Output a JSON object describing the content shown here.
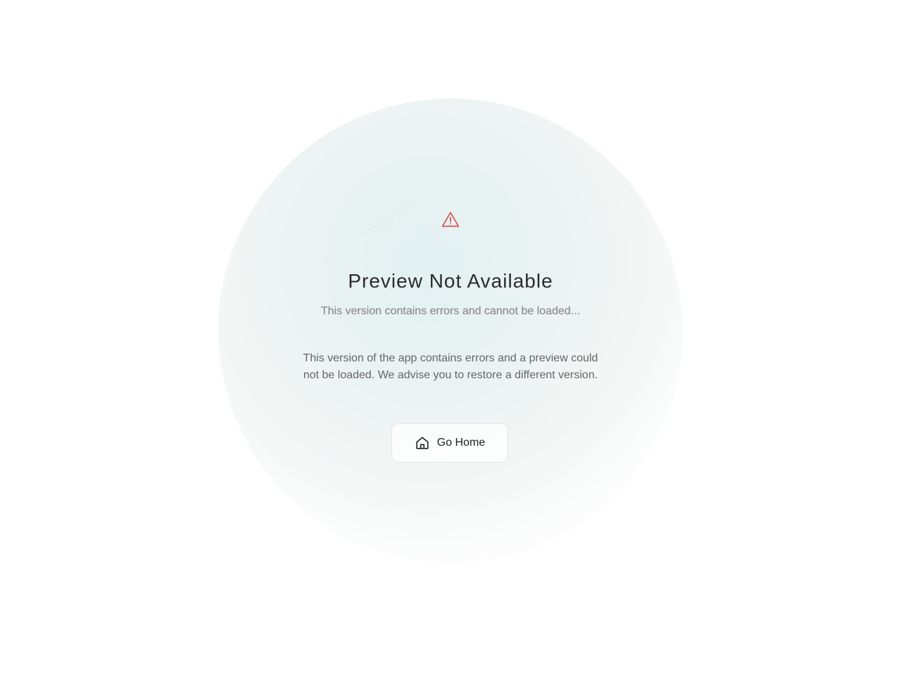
{
  "error_page": {
    "title": "Preview Not Available",
    "subtitle": "This version contains errors and cannot be loaded...",
    "message": "This version of the app contains errors and a preview could not be loaded. We advise you to restore a different version.",
    "home_button_label": "Go Home",
    "icons": {
      "status": "warning-triangle-icon",
      "button": "home-icon"
    },
    "colors": {
      "warning": "#d9534f",
      "title": "#2b2b2b",
      "subtitle": "#8a8a8a",
      "body_text": "#666666"
    }
  }
}
